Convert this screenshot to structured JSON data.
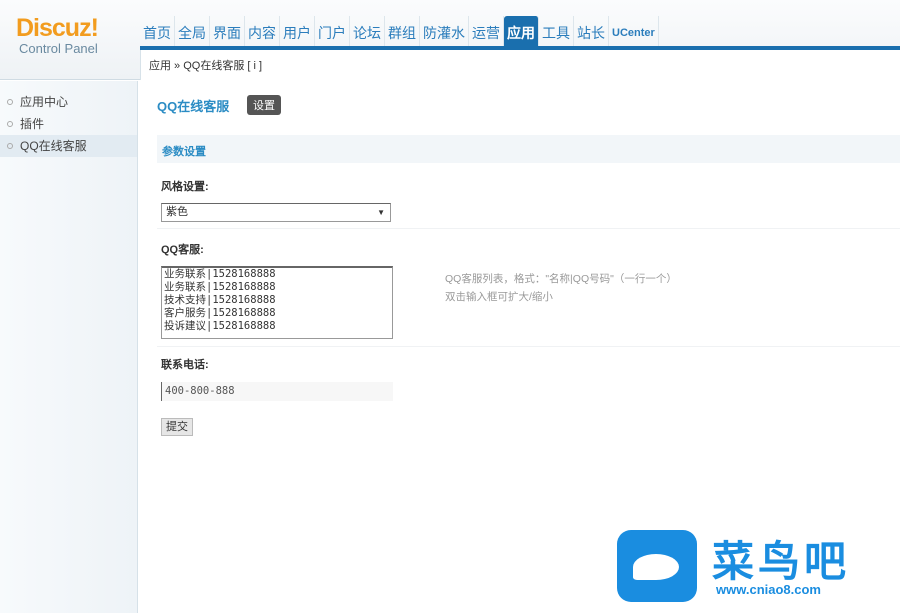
{
  "logo": {
    "brand": "Discuz!",
    "sub": "Control Panel"
  },
  "nav": [
    "首页",
    "全局",
    "界面",
    "内容",
    "用户",
    "门户",
    "论坛",
    "群组",
    "防灌水",
    "运营",
    "应用",
    "工具",
    "站长",
    "UCenter"
  ],
  "nav_active": "应用",
  "breadcrumb": "应用 » QQ在线客服 [ i ]",
  "sidebar": [
    "应用中心",
    "插件",
    "QQ在线客服"
  ],
  "main": {
    "title": "QQ在线客服",
    "settings_button": "设置",
    "section": "参数设置",
    "style_label": "风格设置:",
    "style_value": "紫色",
    "qq_label": "QQ客服:",
    "qq_list": "业务联系|1528168888\n业务联系|1528168888\n技术支持|1528168888\n客户服务|1528168888\n投诉建议|1528168888",
    "qq_tip1": "QQ客服列表，格式：\"名称|QQ号码\"（一行一个）",
    "qq_tip2": "双击输入框可扩大/缩小",
    "phone_label": "联系电话:",
    "phone_value": "400-800-888",
    "submit": "提交"
  },
  "watermark": {
    "text": "菜鸟吧",
    "url": "www.cniao8.com"
  }
}
